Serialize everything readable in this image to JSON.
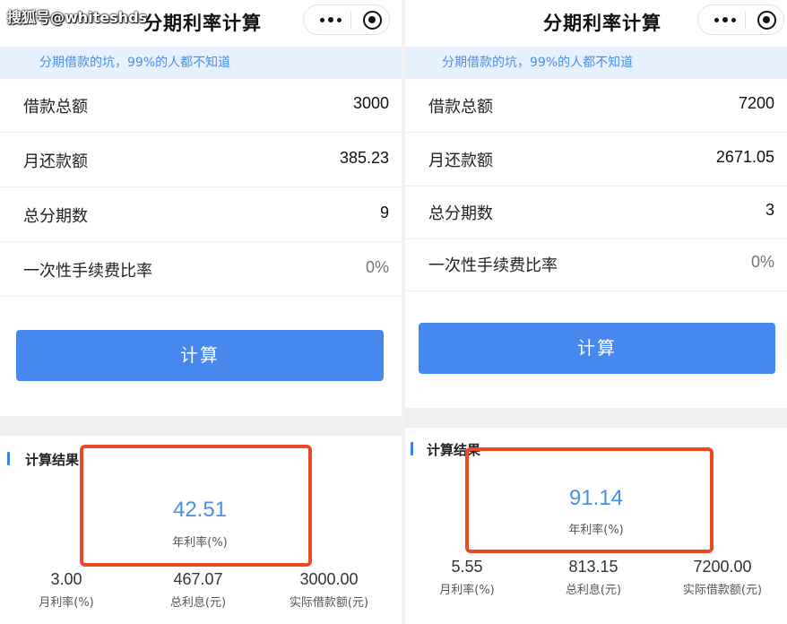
{
  "watermark": "搜狐号@whiteshds",
  "screens": [
    {
      "title": "分期利率计算",
      "notice": "分期借款的坑，99%的人都不知道",
      "fields": [
        {
          "label": "借款总额",
          "value": "3000"
        },
        {
          "label": "月还款额",
          "value": "385.23"
        },
        {
          "label": "总分期数",
          "value": "9"
        },
        {
          "label": "一次性手续费比率",
          "placeholder": "0%"
        }
      ],
      "calc_button": "计算",
      "result_title": "计算结果",
      "annual_rate": {
        "value": "42.51",
        "caption": "年利率(%)"
      },
      "stats": [
        {
          "value": "3.00",
          "caption": "月利率(%)"
        },
        {
          "value": "467.07",
          "caption": "总利息(元)"
        },
        {
          "value": "3000.00",
          "caption": "实际借款额(元)"
        }
      ]
    },
    {
      "title": "分期利率计算",
      "notice": "分期借款的坑，99%的人都不知道",
      "fields": [
        {
          "label": "借款总额",
          "value": "7200"
        },
        {
          "label": "月还款额",
          "value": "2671.05"
        },
        {
          "label": "总分期数",
          "value": "3"
        },
        {
          "label": "一次性手续费比率",
          "placeholder": "0%"
        }
      ],
      "calc_button": "计算",
      "result_title": "计算结果",
      "annual_rate": {
        "value": "91.14",
        "caption": "年利率(%)"
      },
      "stats": [
        {
          "value": "5.55",
          "caption": "月利率(%)"
        },
        {
          "value": "813.15",
          "caption": "总利息(元)"
        },
        {
          "value": "7200.00",
          "caption": "实际借款额(元)"
        }
      ]
    }
  ],
  "colors": {
    "accent": "#4688ee",
    "notice_bg": "#e7f0fd",
    "notice_text": "#4a8ee5",
    "highlight": "#ea4826"
  },
  "icons": [
    "more-dots-icon",
    "close-target-icon"
  ]
}
